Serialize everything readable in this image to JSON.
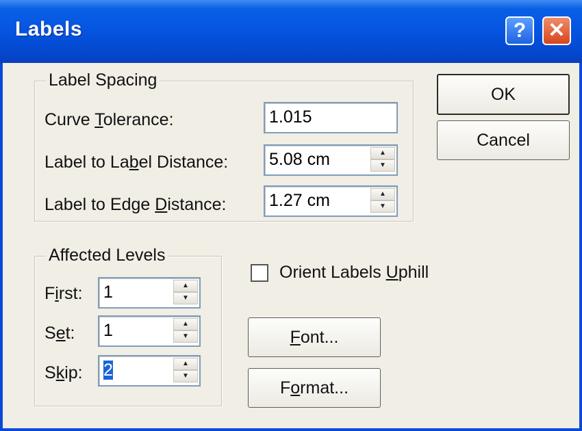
{
  "window": {
    "title": "Labels",
    "help_label": "?",
    "close_label": "✕"
  },
  "label_spacing": {
    "legend": "Label Spacing",
    "curve_tolerance": {
      "label_pre": "Curve ",
      "label_key": "T",
      "label_post": "olerance:",
      "value": "1.015"
    },
    "label_distance": {
      "label_pre": "Label to La",
      "label_key": "b",
      "label_post": "el Distance:",
      "value": "5.08 cm"
    },
    "edge_distance": {
      "label_pre": "Label to Edge ",
      "label_key": "D",
      "label_post": "istance:",
      "value": "1.27 cm"
    }
  },
  "affected_levels": {
    "legend": "Affected Levels",
    "first": {
      "label_pre": "F",
      "label_key": "i",
      "label_post": "rst:",
      "value": "1"
    },
    "set": {
      "label_pre": "S",
      "label_key": "e",
      "label_post": "t:",
      "value": "1"
    },
    "skip": {
      "label_pre": "S",
      "label_key": "k",
      "label_post": "ip:",
      "value": "2"
    }
  },
  "orient": {
    "label_pre": "Orient Labels ",
    "label_key": "U",
    "label_post": "phill",
    "checked": false
  },
  "buttons": {
    "ok": "OK",
    "cancel": "Cancel",
    "font": {
      "key": "F",
      "rest": "ont..."
    },
    "format": {
      "pre": "F",
      "key": "o",
      "rest": "rmat..."
    }
  },
  "spinner": {
    "up": "▲",
    "down": "▼"
  }
}
